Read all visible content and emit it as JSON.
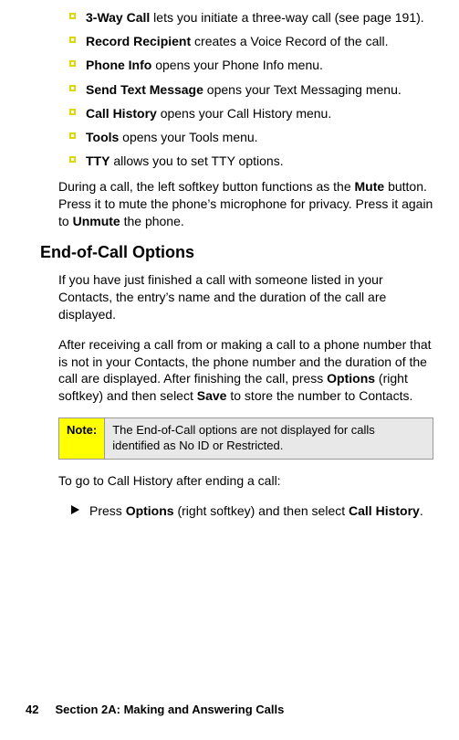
{
  "bullets": [
    {
      "term": "3-Way Call",
      "rest": " lets you initiate a three-way call (see page 191)."
    },
    {
      "term": "Record Recipient",
      "rest": " creates a Voice Record of the call."
    },
    {
      "term": "Phone Info",
      "rest": " opens your Phone Info menu."
    },
    {
      "term": "Send Text Message",
      "rest": " opens your Text Messaging menu."
    },
    {
      "term": "Call History",
      "rest": " opens your Call History menu."
    },
    {
      "term": "Tools",
      "rest": " opens your Tools menu."
    },
    {
      "term": "TTY",
      "rest": " allows you to set TTY options."
    }
  ],
  "during_call": {
    "pre": "During a call, the left softkey button functions as the ",
    "mute": "Mute",
    "mid": " button. Press it to mute the phone’s microphone for privacy. Press it again to ",
    "unmute": "Unmute",
    "post": " the phone."
  },
  "heading": "End-of-Call Options",
  "eoc_para1": "If you have just finished a call with someone listed in your Contacts, the entry’s name and the duration of the call are displayed.",
  "eoc_para2": {
    "pre": "After receiving a call from or making a call to a phone number that is not in your Contacts, the phone number and the duration of the call are displayed. After finishing the call, press ",
    "options": "Options",
    "mid": " (right softkey) and then select ",
    "save": "Save",
    "post": " to store the number to Contacts."
  },
  "note": {
    "label": "Note:",
    "body": "The End-of-Call options are not displayed for calls identified as No ID or Restricted."
  },
  "to_go": "To go to Call History after ending a call:",
  "proc": {
    "pre": "Press ",
    "options": "Options",
    "mid": " (right softkey) and then select ",
    "ch": "Call History",
    "post": "."
  },
  "footer": {
    "page": "42",
    "section": "Section 2A: Making and Answering Calls"
  }
}
